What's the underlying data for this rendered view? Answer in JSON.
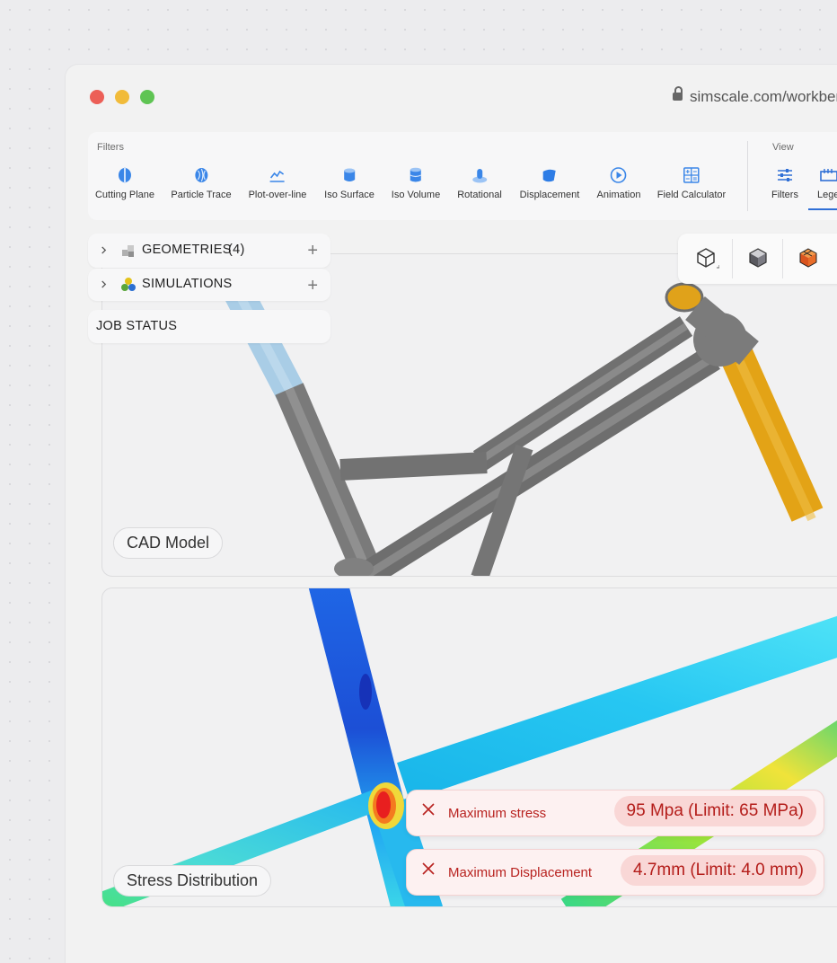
{
  "browser": {
    "url": "simscale.com/workben",
    "traffic_lights": {
      "close": "#ec5f57",
      "minimize": "#f1bb3a",
      "maximize": "#5fc453"
    }
  },
  "ribbon": {
    "filters_label": "Filters",
    "view_label": "View",
    "filter_tools": [
      {
        "label": "Cutting Plane",
        "icon": "cutting-plane-icon"
      },
      {
        "label": "Particle Trace",
        "icon": "particle-trace-icon"
      },
      {
        "label": "Plot-over-line",
        "icon": "plot-over-line-icon"
      },
      {
        "label": "Iso Surface",
        "icon": "iso-surface-icon"
      },
      {
        "label": "Iso Volume",
        "icon": "iso-volume-icon"
      },
      {
        "label": "Rotational",
        "icon": "rotational-icon"
      },
      {
        "label": "Displacement",
        "icon": "displacement-icon"
      },
      {
        "label": "Animation",
        "icon": "animation-icon"
      },
      {
        "label": "Field Calculator",
        "icon": "field-calculator-icon"
      }
    ],
    "view_tools": [
      {
        "label": "Filters",
        "icon": "filters-sliders-icon"
      },
      {
        "label": "Lege",
        "icon": "legend-icon"
      }
    ],
    "accent": "#2f6fd6"
  },
  "tree": {
    "geometries": {
      "label": "GEOMETRIES",
      "count": "(4)"
    },
    "simulations": {
      "label": "SIMULATIONS"
    },
    "job_status": {
      "label": "JOB STATUS"
    }
  },
  "viewports": {
    "cad_label": "CAD Model",
    "stress_label": "Stress Distribution"
  },
  "alerts": [
    {
      "label": "Maximum stress",
      "value": "95 Mpa (Limit: 65 MPa)"
    },
    {
      "label": "Maximum Displacement",
      "value": "4.7mm (Limit: 4.0 mm)"
    }
  ],
  "colors": {
    "alert_text": "#b8221f",
    "frame_gray": "#7a7a7a",
    "head_tube_orange": "#e3a316",
    "seat_tube_blue": "#a9cde6"
  }
}
